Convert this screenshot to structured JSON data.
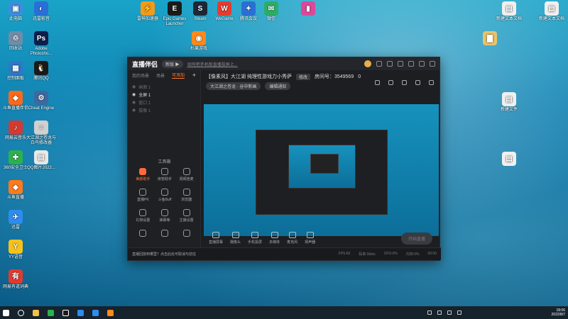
{
  "desktop": {
    "icons": [
      {
        "label": "此电脑",
        "color": "#3b8ede",
        "glyph": "▣"
      },
      {
        "label": "迅雷影音",
        "color": "#2a6fd6",
        "glyph": "◐"
      },
      {
        "label": "回收站",
        "color": "#6f8ca8",
        "glyph": "♲"
      },
      {
        "label": "Adobe Photosho...",
        "color": "#0b1f4d",
        "glyph": "Ps"
      },
      {
        "label": "控制面板",
        "color": "#2e78c8",
        "glyph": "▦"
      },
      {
        "label": "腾讯QQ",
        "color": "#1a1a1a",
        "glyph": "🐧"
      },
      {
        "label": "斗鱼直播伴侣",
        "color": "#ff6a1a",
        "glyph": "◆"
      },
      {
        "label": "Cheat Engine",
        "color": "#3c6aa0",
        "glyph": "⚙"
      },
      {
        "label": "网易云音乐",
        "color": "#d33a31",
        "glyph": "♪"
      },
      {
        "label": "大江湖之苍龙与白鸟修改器",
        "color": "#d0d0d0",
        "glyph": "≡"
      },
      {
        "label": "360安全卫士",
        "color": "#2bb24c",
        "glyph": "✚"
      },
      {
        "label": "QQ图片2022...",
        "color": "#e8e8e8",
        "glyph": "▤"
      },
      {
        "label": "斗鱼直播",
        "color": "#ff7a1a",
        "glyph": "◆"
      },
      {
        "label": "迅雷",
        "color": "#2d8cf0",
        "glyph": "✈"
      },
      {
        "label": "YY语音",
        "color": "#f6c21a",
        "glyph": "Y"
      },
      {
        "label": "网易有道词典",
        "color": "#e23a2e",
        "glyph": "有"
      },
      {
        "label": "雷神加速器",
        "color": "#f39b1a",
        "glyph": "⚡"
      },
      {
        "label": "Epic Games Launcher",
        "color": "#1a1a1a",
        "glyph": "E"
      },
      {
        "label": "Steam",
        "color": "#1b2838",
        "glyph": "S"
      },
      {
        "label": "WeGame",
        "color": "#e63b2e",
        "glyph": "W"
      },
      {
        "label": "腾讯会议",
        "color": "#2a6fd6",
        "glyph": "✦"
      },
      {
        "label": "微信",
        "color": "#2aae67",
        "glyph": "✉"
      },
      {
        "label": "",
        "color": "#d94a9a",
        "glyph": "▮"
      },
      {
        "label": "杉果游戏",
        "color": "#ff8a1a",
        "glyph": "◉"
      },
      {
        "label": "新建文本文档",
        "color": "#f0f0f0",
        "glyph": "▤"
      },
      {
        "label": "新建文本文档",
        "color": "#f0f0f0",
        "glyph": "▤"
      },
      {
        "label": "",
        "color": "#e8c36a",
        "glyph": "▇"
      },
      {
        "label": "新建文件",
        "color": "#f0f0f0",
        "glyph": "▤"
      },
      {
        "label": "",
        "color": "#f0f0f0",
        "glyph": "▤"
      }
    ]
  },
  "window": {
    "app_name": "直播伴侣",
    "version_label": "新版 ▶",
    "notice": "如何把手机版直播投屏上...",
    "tabs": [
      "我的场景",
      "场景",
      "可添加"
    ],
    "add_label": "+",
    "scenes": [
      {
        "label": "画面 1",
        "on": false
      },
      {
        "label": "全屏 1",
        "on": true
      },
      {
        "label": "窗口 1",
        "on": false
      },
      {
        "label": "摄像 1",
        "on": false
      }
    ],
    "tools_title": "工具箱",
    "tools": [
      {
        "label": "美颜助手",
        "hot": true
      },
      {
        "label": "房管助手",
        "hot": false
      },
      {
        "label": "视频连麦",
        "hot": false
      },
      {
        "label": "直播PK",
        "hot": false
      },
      {
        "label": "斗鱼Buff",
        "hot": false
      },
      {
        "label": "浏览器",
        "hot": false
      },
      {
        "label": "礼物设置",
        "hot": false
      },
      {
        "label": "弹幕等",
        "hot": false
      },
      {
        "label": "主播设置",
        "hot": false
      },
      {
        "label": "",
        "hot": false
      },
      {
        "label": "",
        "hot": false
      },
      {
        "label": "",
        "hot": false
      }
    ],
    "room_title": "【像素风】大江湖 纯理性游戏力小秀萨",
    "room_tag": "修改",
    "room_id": "房间号：3549569",
    "room_fans": "0",
    "category_pill": "大江湖之苍龙 · 谷中新画",
    "edit_pill": "编辑通知",
    "controls": [
      {
        "label": "直播屏幕"
      },
      {
        "label": "摄像头"
      },
      {
        "label": "手机投屏"
      },
      {
        "label": "多媒体"
      },
      {
        "label": "麦克风"
      },
      {
        "label": "扬声器"
      }
    ],
    "start_button": "开始直播",
    "status_tip": "直播回放到哪里？点击此处可取消与前往",
    "status_items": [
      "FPS:60",
      "码率:0kb/s",
      "CPU:0%",
      "内存:0%",
      "00:00"
    ]
  },
  "taskbar": {
    "clock_time": "18:06",
    "clock_date": "2022/8/7"
  }
}
